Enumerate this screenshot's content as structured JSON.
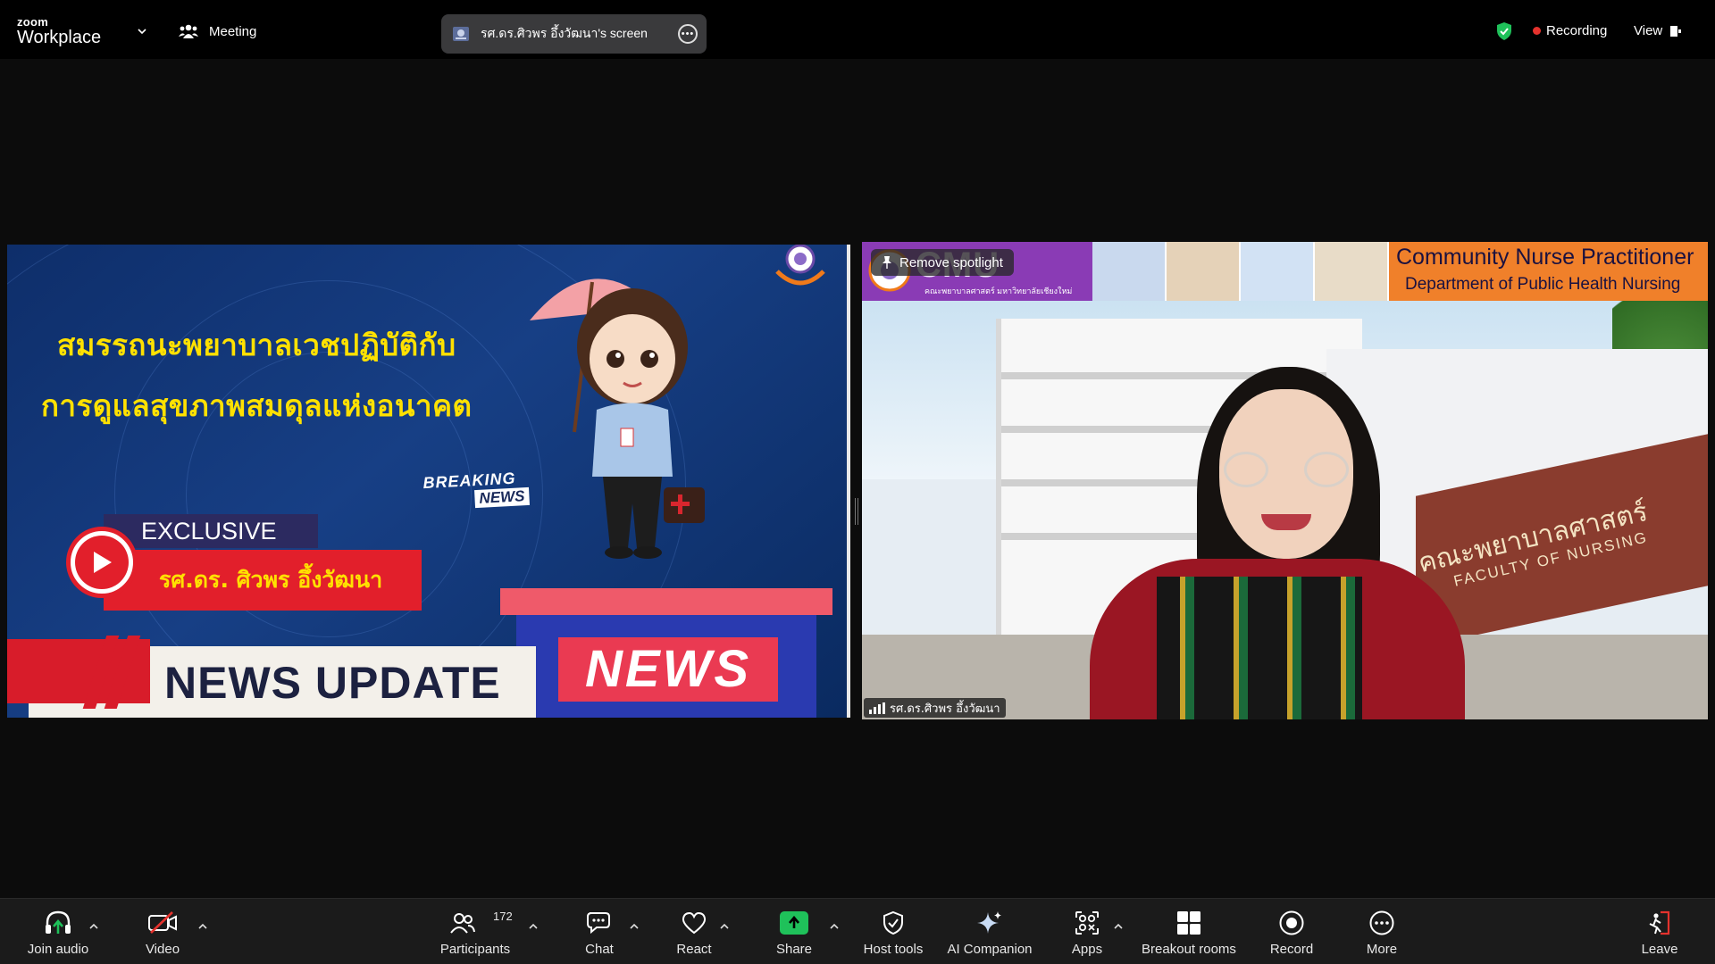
{
  "topbar": {
    "logo_small": "zoom",
    "logo_big": "Workplace",
    "meeting_label": "Meeting",
    "screen_share_label": "รศ.ดร.ศิวพร อึ้งวัฒนา's screen",
    "recording_label": "Recording",
    "view_label": "View"
  },
  "shared_screen": {
    "headline_line1": "สมรรถนะพยาบาลเวชปฏิบัติกับ",
    "headline_line2": "การดูแลสุขภาพสมดุลแห่งอนาคต",
    "exclusive_label": "EXCLUSIVE",
    "presenter_name": "รศ.ดร. ศิวพร  อึ้งวัฒนา",
    "breaking_word1": "BREAKING",
    "breaking_word2": "NEWS",
    "news_label": "NEWS",
    "news_update_label": "NEWS UPDATE"
  },
  "video_tile": {
    "spotlight_label": "Remove spotlight",
    "banner_title": "CMU",
    "banner_sub": "คณะพยาบาลศาสตร์ มหาวิทยาลัยเชียงใหม่",
    "banner_right_title": "Community Nurse Practitioner",
    "banner_right_sub": "Department of Public Health Nursing",
    "sign_thai": "คณะพยาบาลศาสตร์",
    "sign_english": "FACULTY OF NURSING",
    "participant_name": "รศ.ดร.ศิวพร อึ้งวัฒนา"
  },
  "toolbar": {
    "join_audio": "Join audio",
    "video": "Video",
    "participants": "Participants",
    "participant_count": "172",
    "chat": "Chat",
    "react": "React",
    "share": "Share",
    "host_tools": "Host tools",
    "ai_companion": "AI Companion",
    "apps": "Apps",
    "breakout_rooms": "Breakout rooms",
    "record": "Record",
    "more": "More",
    "leave": "Leave"
  },
  "colors": {
    "accent_green": "#1fc15a",
    "record_red": "#e5322d",
    "headline_yellow": "#ffe100",
    "leave_red": "#e5322d"
  },
  "icons": [
    "chevron-down-icon",
    "meeting-icon",
    "screen-thumbnail-icon",
    "more-options-icon",
    "shield-check-icon",
    "view-icon",
    "headphone-icon",
    "video-off-icon",
    "participants-icon",
    "chat-icon",
    "heart-icon",
    "share-up-icon",
    "shield-icon",
    "sparkle-icon",
    "apps-icon",
    "grid-icon",
    "record-icon",
    "more-icon",
    "leave-icon",
    "pin-icon",
    "signal-icon",
    "play-icon"
  ]
}
